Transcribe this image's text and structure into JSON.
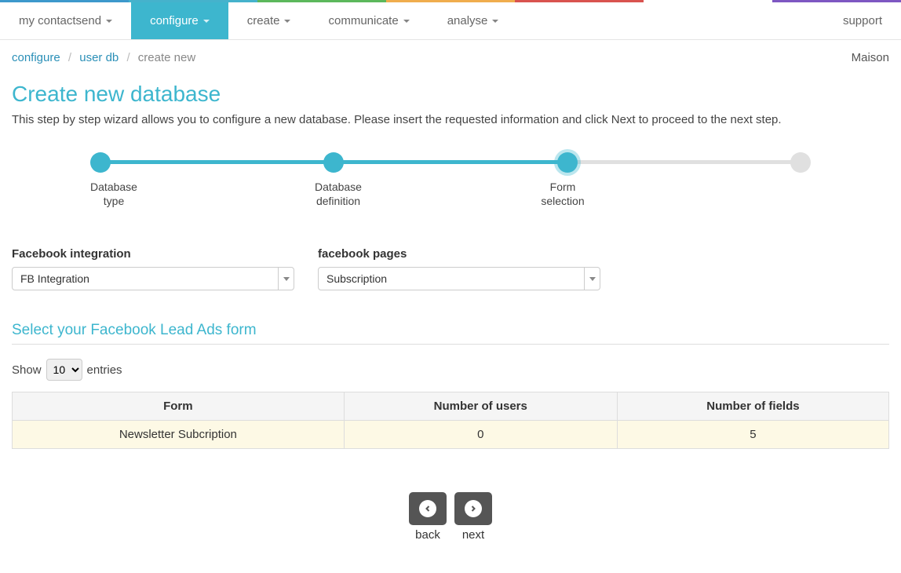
{
  "nav": {
    "items": [
      {
        "label": "my contactsend",
        "active": false,
        "caret": true
      },
      {
        "label": "configure",
        "active": true,
        "caret": true
      },
      {
        "label": "create",
        "active": false,
        "caret": true
      },
      {
        "label": "communicate",
        "active": false,
        "caret": true
      },
      {
        "label": "analyse",
        "active": false,
        "caret": true
      }
    ],
    "support": "support"
  },
  "breadcrumb": {
    "configure": "configure",
    "userdb": "user db",
    "current": "create new"
  },
  "account": "Maison",
  "heading": "Create new database",
  "description": "This step by step wizard allows you to configure a new database. Please insert the requested information and click Next to proceed to the next step.",
  "steps": [
    {
      "label": "Database type",
      "active": true
    },
    {
      "label": "Database definition",
      "active": true
    },
    {
      "label": "Form selection",
      "active": true,
      "current": true
    },
    {
      "label": "",
      "active": false
    }
  ],
  "fields": {
    "fb_integration": {
      "label": "Facebook integration",
      "value": "FB Integration"
    },
    "fb_pages": {
      "label": "facebook pages",
      "value": "Subscription"
    }
  },
  "section_title": "Select your Facebook Lead Ads form",
  "table": {
    "show_label_pre": "Show",
    "show_value": "10",
    "show_label_post": "entries",
    "headers": {
      "form": "Form",
      "users": "Number of users",
      "fields": "Number of fields"
    },
    "rows": [
      {
        "form": "Newsletter Subcription",
        "users": "0",
        "fields": "5",
        "selected": true
      }
    ]
  },
  "buttons": {
    "back": "back",
    "next": "next"
  }
}
